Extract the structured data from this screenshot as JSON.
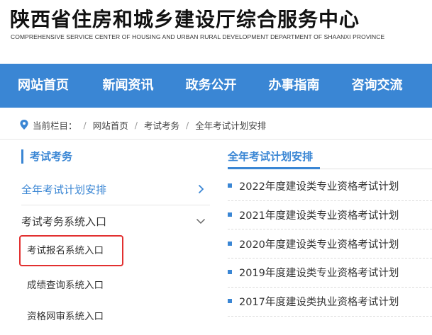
{
  "header": {
    "title": "陕西省住房和城乡建设厅综合服务中心",
    "subtitle": "COMPREHENSIVE SERVICE CENTER OF HOUSING AND URBAN RURAL DEVELOPMENT DEPARTMENT OF SHAANXI PROVINCE"
  },
  "nav": {
    "items": [
      "网站首页",
      "新闻资讯",
      "政务公开",
      "办事指南",
      "咨询交流"
    ]
  },
  "breadcrumb": {
    "prefix": "当前栏目：",
    "items": [
      "网站首页",
      "考试考务",
      "全年考试计划安排"
    ]
  },
  "sidebar": {
    "title": "考试考务",
    "items": [
      {
        "label": "全年考试计划安排"
      },
      {
        "label": "考试考务系统入口"
      }
    ],
    "subitems": [
      "考试报名系统入口",
      "成绩查询系统入口",
      "资格网审系统入口"
    ]
  },
  "main": {
    "title": "全年考试计划安排",
    "list": [
      "2022年度建设类专业资格考试计划",
      "2021年度建设类专业资格考试计划",
      "2020年度建设类专业资格考试计划",
      "2019年度建设类专业资格考试计划",
      "2017年度建设类执业资格考试计划"
    ]
  },
  "colors": {
    "accent": "#3a86d4",
    "highlight": "#e23030"
  }
}
